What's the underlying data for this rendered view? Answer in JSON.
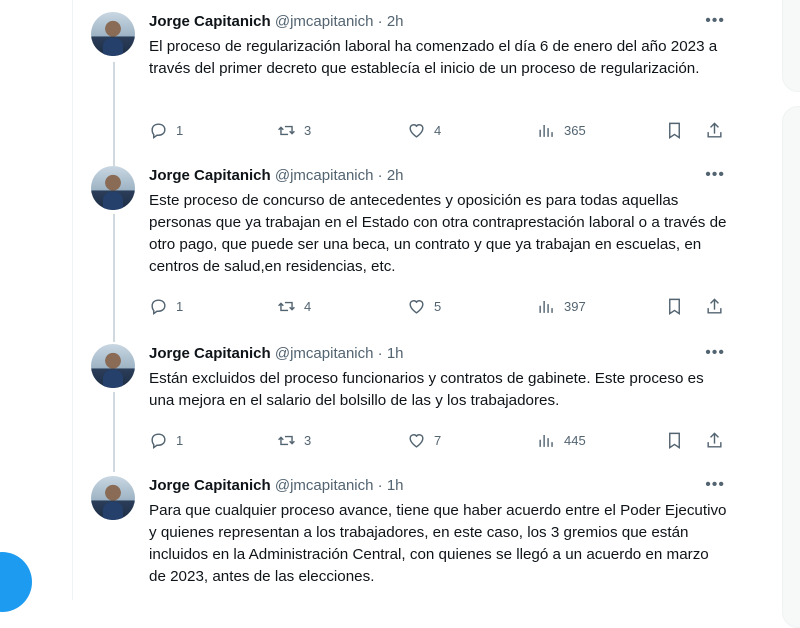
{
  "colors": {
    "accent": "#1d9bf0",
    "text": "#0f1419",
    "muted": "#536471",
    "thread_line": "#cfd9de"
  },
  "tweets": [
    {
      "author": "Jorge Capitanich",
      "handle": "@jmcapitanich",
      "dot": "·",
      "time": "2h",
      "text": "El proceso de regularización laboral ha comenzado el día 6 de enero del año 2023 a través del primer decreto que establecía el inicio de un proceso de regularización.",
      "replies": "1",
      "retweets": "3",
      "likes": "4",
      "views": "365"
    },
    {
      "author": "Jorge Capitanich",
      "handle": "@jmcapitanich",
      "dot": "·",
      "time": "2h",
      "text": "Este proceso de concurso de antecedentes y oposición es para todas aquellas personas que ya trabajan en el Estado con otra contraprestación laboral o a través de otro pago, que puede ser una beca, un contrato y que ya trabajan en escuelas, en centros de salud,en residencias, etc.",
      "replies": "1",
      "retweets": "4",
      "likes": "5",
      "views": "397"
    },
    {
      "author": "Jorge Capitanich",
      "handle": "@jmcapitanich",
      "dot": "·",
      "time": "1h",
      "text": "Están excluidos del proceso funcionarios y contratos de gabinete. Este proceso es una mejora en el salario del bolsillo de las y los trabajadores.",
      "replies": "1",
      "retweets": "3",
      "likes": "7",
      "views": "445"
    },
    {
      "author": "Jorge Capitanich",
      "handle": "@jmcapitanich",
      "dot": "·",
      "time": "1h",
      "text": "Para que cualquier proceso avance, tiene que haber acuerdo entre el Poder Ejecutivo y quienes representan a los trabajadores, en este caso, los 3 gremios que están incluidos en la Administración Central, con quienes se llegó a un acuerdo en marzo de 2023, antes de las elecciones."
    }
  ],
  "icons": {
    "more": "more-icon",
    "reply": "reply-icon",
    "retweet": "retweet-icon",
    "like": "heart-icon",
    "views": "views-icon",
    "bookmark": "bookmark-icon",
    "share": "share-icon"
  }
}
